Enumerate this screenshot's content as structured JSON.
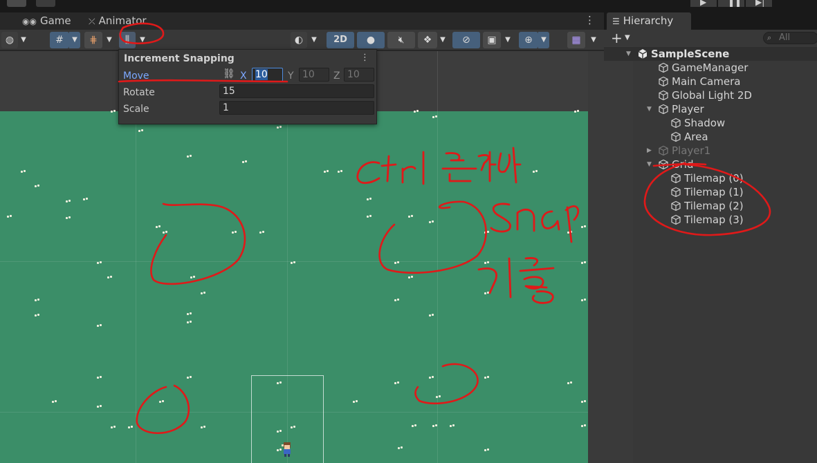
{
  "scene_panel": {
    "tabs": [
      {
        "label": "Game",
        "icon": "gamepad-icon"
      },
      {
        "label": "Animator",
        "icon": "animator-icon"
      }
    ],
    "toolbar": {
      "mode_2d": "2D"
    }
  },
  "snap_popup": {
    "title": "Increment Snapping",
    "rows": {
      "move": {
        "label": "Move",
        "x_axis": "X",
        "x": "10",
        "y_axis": "Y",
        "y": "10",
        "z_axis": "Z",
        "z": "10"
      },
      "rotate": {
        "label": "Rotate",
        "value": "15"
      },
      "scale": {
        "label": "Scale",
        "value": "1"
      }
    }
  },
  "hierarchy": {
    "tab_label": "Hierarchy",
    "search_placeholder": "All",
    "items": [
      {
        "label": "SampleScene",
        "depth": 0,
        "type": "scene",
        "expanded": true
      },
      {
        "label": "GameManager",
        "depth": 1
      },
      {
        "label": "Main Camera",
        "depth": 1
      },
      {
        "label": "Global Light 2D",
        "depth": 1
      },
      {
        "label": "Player",
        "depth": 1,
        "expanded": true
      },
      {
        "label": "Shadow",
        "depth": 2
      },
      {
        "label": "Area",
        "depth": 2
      },
      {
        "label": "Player1",
        "depth": 1,
        "expanded": false,
        "disabled": true
      },
      {
        "label": "Grid",
        "depth": 1,
        "expanded": true
      },
      {
        "label": "Tilemap (0)",
        "depth": 2
      },
      {
        "label": "Tilemap (1)",
        "depth": 2
      },
      {
        "label": "Tilemap (2)",
        "depth": 2
      },
      {
        "label": "Tilemap (3)",
        "depth": 2
      }
    ]
  },
  "colors": {
    "grass": "#3b8e68",
    "annotation": "#e01919",
    "accent_blue": "#7ca8ff"
  }
}
